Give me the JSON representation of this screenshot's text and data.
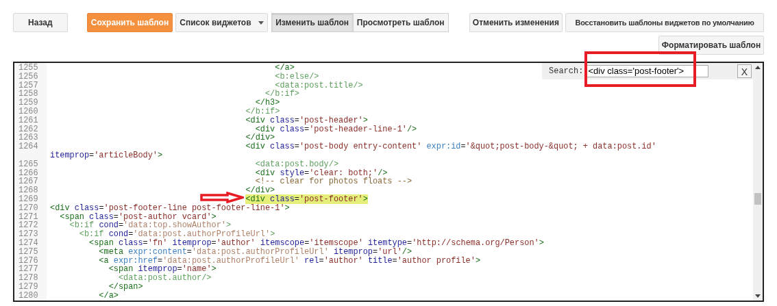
{
  "toolbar": {
    "back_button": "Назад",
    "save_button": "Сохранить шаблон",
    "widgets_dropdown": "Список виджетов",
    "mode_tabs": [
      {
        "label": "Изменить шаблон",
        "selected": true
      },
      {
        "label": "Просмотреть шаблон",
        "selected": false
      }
    ],
    "revert_button": "Отменить изменения",
    "restore_button": "Восстановить шаблоны виджетов по умолчанию",
    "format_button": "Форматировать шаблон"
  },
  "search": {
    "label": "Search:",
    "value": "<div class='post-footer'>",
    "close_button": "X"
  },
  "editor": {
    "lines": [
      {
        "number": "1255",
        "text": "                                              </a>",
        "highlighted": false
      },
      {
        "number": "1256",
        "text": "                                              <b:else/>",
        "highlighted": false
      },
      {
        "number": "1257",
        "text": "                                              <data:post.title/>",
        "highlighted": false
      },
      {
        "number": "1258",
        "text": "                                            </b:if>",
        "highlighted": false
      },
      {
        "number": "1259",
        "text": "                                          </h3>",
        "highlighted": false
      },
      {
        "number": "1260",
        "text": "                                        </b:if>",
        "highlighted": false
      },
      {
        "number": "1261",
        "text": "                                        <div class='post-header'>",
        "highlighted": false
      },
      {
        "number": "1262",
        "text": "                                          <div class='post-header-line-1'/>",
        "highlighted": false
      },
      {
        "number": "1263",
        "text": "                                        </div>",
        "highlighted": false
      },
      {
        "number": "1264",
        "text": "                                        <div class='post-body entry-content' expr:id='&quot;post-body-&quot; + data:post.id'",
        "wrapped_text": "itemprop='articleBody'>",
        "highlighted": false
      },
      {
        "number": "1265",
        "text": "                                          <data:post.body/>",
        "highlighted": false
      },
      {
        "number": "1266",
        "text": "                                          <div style='clear: both;'/>",
        "highlighted": false
      },
      {
        "number": "1267",
        "text": "                                          <!-- clear for photos floats -->",
        "highlighted": false
      },
      {
        "number": "1268",
        "text": "                                        </div>",
        "highlighted": false
      },
      {
        "number": "1269",
        "text": "                                        <div class='post-footer'>",
        "highlighted": true
      },
      {
        "number": "1270",
        "text": "<div class='post-footer-line post-footer-line-1'>",
        "highlighted": false
      },
      {
        "number": "1271",
        "text": "  <span class='post-author vcard'>",
        "highlighted": false
      },
      {
        "number": "1272",
        "text": "    <b:if cond='data:top.showAuthor'>",
        "highlighted": false
      },
      {
        "number": "1273",
        "text": "      <b:if cond='data:post.authorProfileUrl'>",
        "highlighted": false
      },
      {
        "number": "1274",
        "text": "        <span class='fn' itemprop='author' itemscope='itemscope' itemtype='http://schema.org/Person'>",
        "highlighted": false
      },
      {
        "number": "1275",
        "text": "          <meta expr:content='data:post.authorProfileUrl' itemprop='url'/>",
        "highlighted": false
      },
      {
        "number": "1276",
        "text": "          <a expr:href='data:post.authorProfileUrl' rel='author' title='author profile'>",
        "highlighted": false
      },
      {
        "number": "1277",
        "text": "            <span itemprop='name'>",
        "highlighted": false
      },
      {
        "number": "1278",
        "text": "              <data:post.author/>",
        "highlighted": false
      },
      {
        "number": "1279",
        "text": "            </span>",
        "highlighted": false
      },
      {
        "number": "1280",
        "text": "          </a>",
        "highlighted": false
      }
    ]
  }
}
